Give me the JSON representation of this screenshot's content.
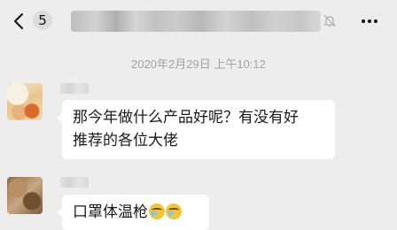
{
  "header": {
    "unread_count": "5",
    "back_icon": "chevron-left-icon",
    "mute_icon": "bell-slash-icon",
    "more_icon": "ellipsis-icon"
  },
  "timestamp": "2020年2月29日 上午10:12",
  "messages": [
    {
      "text_line1": "那今年做什么产品好呢？有没有好",
      "text_line2": "推荐的各位大佬"
    },
    {
      "text": "口罩体温枪",
      "emoji": [
        "laughing-tears-emoji",
        "laughing-tears-emoji"
      ]
    }
  ],
  "colors": {
    "background": "#ededed",
    "bubble": "#ffffff",
    "timestamp": "#a3a3a3"
  }
}
